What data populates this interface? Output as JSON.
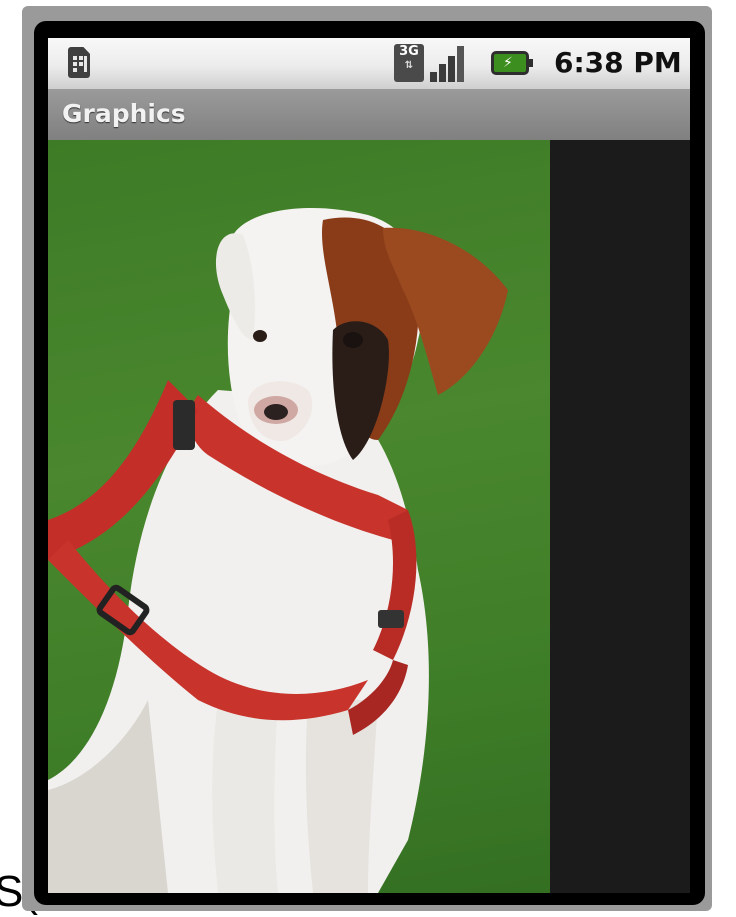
{
  "status_bar": {
    "network_label": "3G",
    "network_arrows": "⇅",
    "time": "6:38 PM",
    "icons": [
      "sim-card-icon",
      "network-3g-icon",
      "signal-strength-icon",
      "battery-charging-icon"
    ],
    "battery_color": "#3c8f1e"
  },
  "app": {
    "title": "Graphics"
  },
  "content": {
    "image": "photo of a white and brown boxer puppy wearing a red harness sitting on grass",
    "colors": {
      "grass": "#4c8a2f",
      "harness": "#c8332b",
      "fur_brown": "#8a3c18"
    }
  },
  "background_text": "S("
}
